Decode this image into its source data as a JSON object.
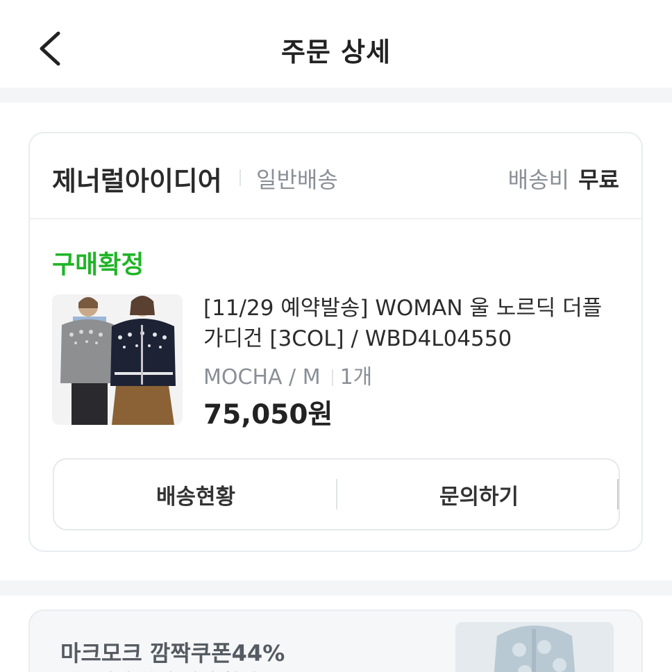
{
  "header": {
    "title": "주문 상세",
    "back_icon": "chevron-left-icon"
  },
  "order": {
    "seller_name": "제너럴아이디어",
    "shipping_type": "일반배송",
    "shipping_fee_label": "배송비",
    "shipping_fee_value": "무료",
    "status": "구매확정",
    "product": {
      "name": "[11/29 예약발송] WOMAN 울 노르딕 더플 가디건 [3COL] / WBD4L04550",
      "option": "MOCHA / M",
      "quantity": "1개",
      "price": "75,050원"
    },
    "buttons": {
      "tracking": "배송현황",
      "inquiry": "문의하기"
    }
  },
  "promo": {
    "title": "마크모크 깜짝쿠폰44%",
    "subtitle": "마음껏의 아기 패션 할인"
  },
  "colors": {
    "status_green": "#1fb527",
    "divider_bg": "#f3f5f7"
  }
}
